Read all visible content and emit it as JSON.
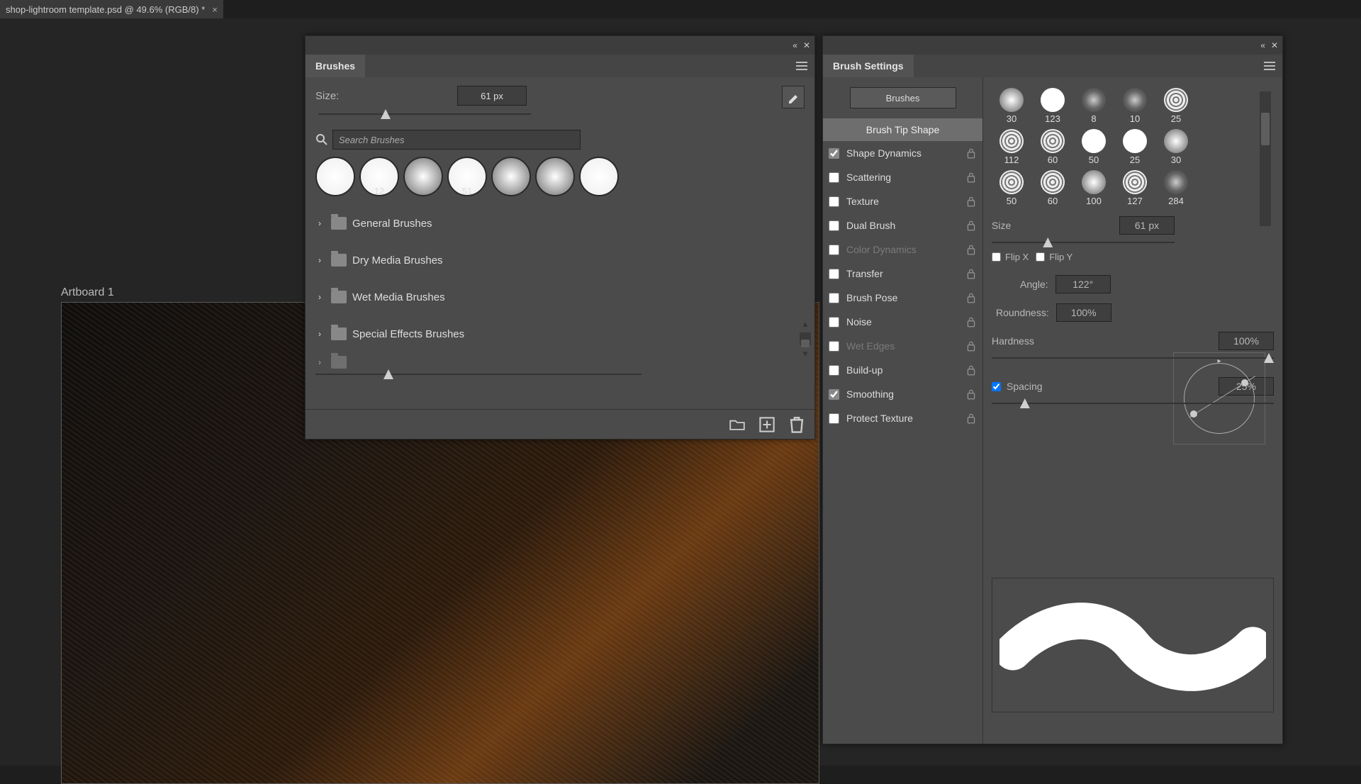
{
  "document": {
    "tab_title": "shop-lightroom template.psd @ 49.6% (RGB/8) *",
    "artboard_label": "Artboard 1"
  },
  "brushes_panel": {
    "title": "Brushes",
    "size_label": "Size:",
    "size_value": "61 px",
    "search_placeholder": "Search Brushes",
    "recent": [
      {
        "label": "",
        "style": "hard"
      },
      {
        "label": "12",
        "style": "hard"
      },
      {
        "label": "",
        "style": "soft"
      },
      {
        "label": "51",
        "style": "hard"
      },
      {
        "label": "",
        "style": "soft"
      },
      {
        "label": "",
        "style": "soft"
      },
      {
        "label": "",
        "style": "hard"
      }
    ],
    "folders": [
      "General Brushes",
      "Dry Media Brushes",
      "Wet Media Brushes",
      "Special Effects Brushes"
    ]
  },
  "settings_panel": {
    "title": "Brush Settings",
    "brushes_button": "Brushes",
    "tip_shape_label": "Brush Tip Shape",
    "options": [
      {
        "label": "Shape Dynamics",
        "checked": true,
        "lock": true,
        "dim": false
      },
      {
        "label": "Scattering",
        "checked": false,
        "lock": true,
        "dim": false
      },
      {
        "label": "Texture",
        "checked": false,
        "lock": true,
        "dim": false
      },
      {
        "label": "Dual Brush",
        "checked": false,
        "lock": true,
        "dim": false
      },
      {
        "label": "Color Dynamics",
        "checked": false,
        "lock": true,
        "dim": true
      },
      {
        "label": "Transfer",
        "checked": false,
        "lock": true,
        "dim": false
      },
      {
        "label": "Brush Pose",
        "checked": false,
        "lock": true,
        "dim": false
      },
      {
        "label": "Noise",
        "checked": false,
        "lock": true,
        "dim": false
      },
      {
        "label": "Wet Edges",
        "checked": false,
        "lock": true,
        "dim": true
      },
      {
        "label": "Build-up",
        "checked": false,
        "lock": true,
        "dim": false
      },
      {
        "label": "Smoothing",
        "checked": true,
        "lock": true,
        "dim": false
      },
      {
        "label": "Protect Texture",
        "checked": false,
        "lock": true,
        "dim": false
      }
    ],
    "tips": [
      {
        "label": "30",
        "style": "soft"
      },
      {
        "label": "123",
        "style": "hard"
      },
      {
        "label": "8",
        "style": "spray"
      },
      {
        "label": "10",
        "style": "spray"
      },
      {
        "label": "25",
        "style": "tex"
      },
      {
        "label": "112",
        "style": "tex"
      },
      {
        "label": "60",
        "style": "tex"
      },
      {
        "label": "50",
        "style": "hard"
      },
      {
        "label": "25",
        "style": "hard"
      },
      {
        "label": "30",
        "style": "soft"
      },
      {
        "label": "50",
        "style": "tex"
      },
      {
        "label": "60",
        "style": "tex"
      },
      {
        "label": "100",
        "style": "soft"
      },
      {
        "label": "127",
        "style": "tex"
      },
      {
        "label": "284",
        "style": "spray"
      }
    ],
    "size_label": "Size",
    "size_value": "61 px",
    "flip_x_label": "Flip X",
    "flip_y_label": "Flip Y",
    "flip_x": false,
    "flip_y": false,
    "angle_label": "Angle:",
    "angle_value": "122°",
    "roundness_label": "Roundness:",
    "roundness_value": "100%",
    "hardness_label": "Hardness",
    "hardness_value": "100%",
    "spacing_label": "Spacing",
    "spacing_checked": true,
    "spacing_value": "25%"
  }
}
